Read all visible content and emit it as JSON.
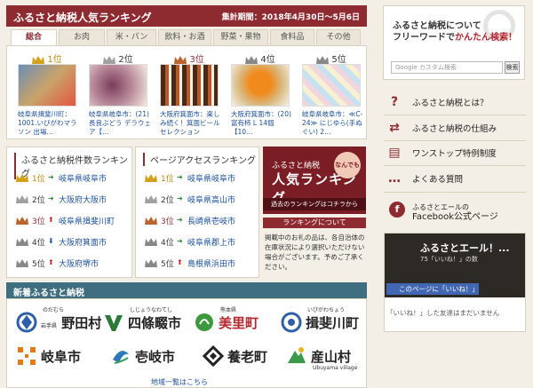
{
  "ranking": {
    "title": "ふるさと納税人気ランキング",
    "period": "集計期間：2018年4月30日〜5月6日",
    "tabs": [
      "総合",
      "お肉",
      "米・パン",
      "飲料・お酒",
      "野菜・果物",
      "食料品",
      "その他"
    ],
    "items": [
      {
        "rank": "1位",
        "desc": "岐阜県揖斐川町：1001.いびがわマラソン 出場…"
      },
      {
        "rank": "2位",
        "desc": "岐阜県岐阜市：(21)長良ぶどう デラウェア【…"
      },
      {
        "rank": "3位",
        "desc": "大阪府箕面市：楽しみ続く！箕面ビールセレクション"
      },
      {
        "rank": "4位",
        "desc": "大阪府箕面市：(20)富有柿 L 14個【10…"
      },
      {
        "rank": "5位",
        "desc": "岐阜県岐阜市：≪C-24≫ にじゆら(手ぬぐい) 2…"
      }
    ]
  },
  "count_ranking": {
    "title": "ふるさと納税件数ランキング",
    "rows": [
      {
        "rank": "1位",
        "name": "岐阜県岐阜市"
      },
      {
        "rank": "2位",
        "name": "大阪府大阪市"
      },
      {
        "rank": "3位",
        "name": "岐阜県揖斐川町"
      },
      {
        "rank": "4位",
        "name": "大阪府箕面市"
      },
      {
        "rank": "5位",
        "name": "大阪府堺市"
      }
    ]
  },
  "access_ranking": {
    "title": "ページアクセスランキング",
    "rows": [
      {
        "rank": "1位",
        "name": "岐阜県岐阜市"
      },
      {
        "rank": "2位",
        "name": "岐阜県高山市"
      },
      {
        "rank": "3位",
        "name": "長崎県壱岐市"
      },
      {
        "rank": "4位",
        "name": "岐阜県郡上市"
      },
      {
        "rank": "5位",
        "name": "島根県浜田市"
      }
    ]
  },
  "banner": {
    "line1": "ふるさと納税",
    "line2": "人気ランキング",
    "badge": "なんでも",
    "past_link": "過去のランキングはコチラから"
  },
  "about": {
    "title": "ランキングについて",
    "text": "掲載中のお礼の品は、各自治体の在庫状況により選択いただけない場合がございます。予めご了承ください。"
  },
  "new_arrivals": {
    "title": "新着ふるさと納税",
    "municipalities": [
      {
        "name": "野田村",
        "ruby": "のだむら",
        "pref": "岩手県"
      },
      {
        "name": "四條畷市",
        "ruby": "しじょうなわてし",
        "pref": ""
      },
      {
        "name": "美里町",
        "ruby": "熊本県",
        "pref": ""
      },
      {
        "name": "揖斐川町",
        "ruby": "いびがわちょう",
        "pref": ""
      },
      {
        "name": "岐阜市",
        "ruby": "",
        "pref": ""
      },
      {
        "name": "壱岐市",
        "ruby": "",
        "pref": ""
      },
      {
        "name": "養老町",
        "ruby": "",
        "pref": ""
      },
      {
        "name": "産山村",
        "ruby": "Ubuyama village",
        "pref": ""
      }
    ],
    "area_link": "地域一覧はこちら"
  },
  "search": {
    "title_line1": "ふるさと納税について",
    "title_line2_a": "フリーワードで",
    "title_line2_b": "かんたん検索！",
    "placeholder": "Google カスタム検索",
    "button": "検索"
  },
  "menu": [
    {
      "icon": "question-icon",
      "label": "ふるさと納税とは？"
    },
    {
      "icon": "flow-icon",
      "label": "ふるさと納税の仕組み"
    },
    {
      "icon": "document-icon",
      "label": "ワンストップ特例制度"
    },
    {
      "icon": "chat-icon",
      "label": "よくある質問"
    }
  ],
  "facebook": {
    "title_line1": "ふるさとエールの",
    "title_line2": "Facebook公式ページ",
    "widget_title": "ふるさとエール！...",
    "widget_likes": "75「いいね！」の数",
    "like_button": "このページに「いいね！」",
    "friends_text": "「いいね！」した友達はまだいません"
  },
  "colors": {
    "accent": "#8e2b31",
    "teal": "#3e6e80",
    "link": "#1a4f9c"
  }
}
